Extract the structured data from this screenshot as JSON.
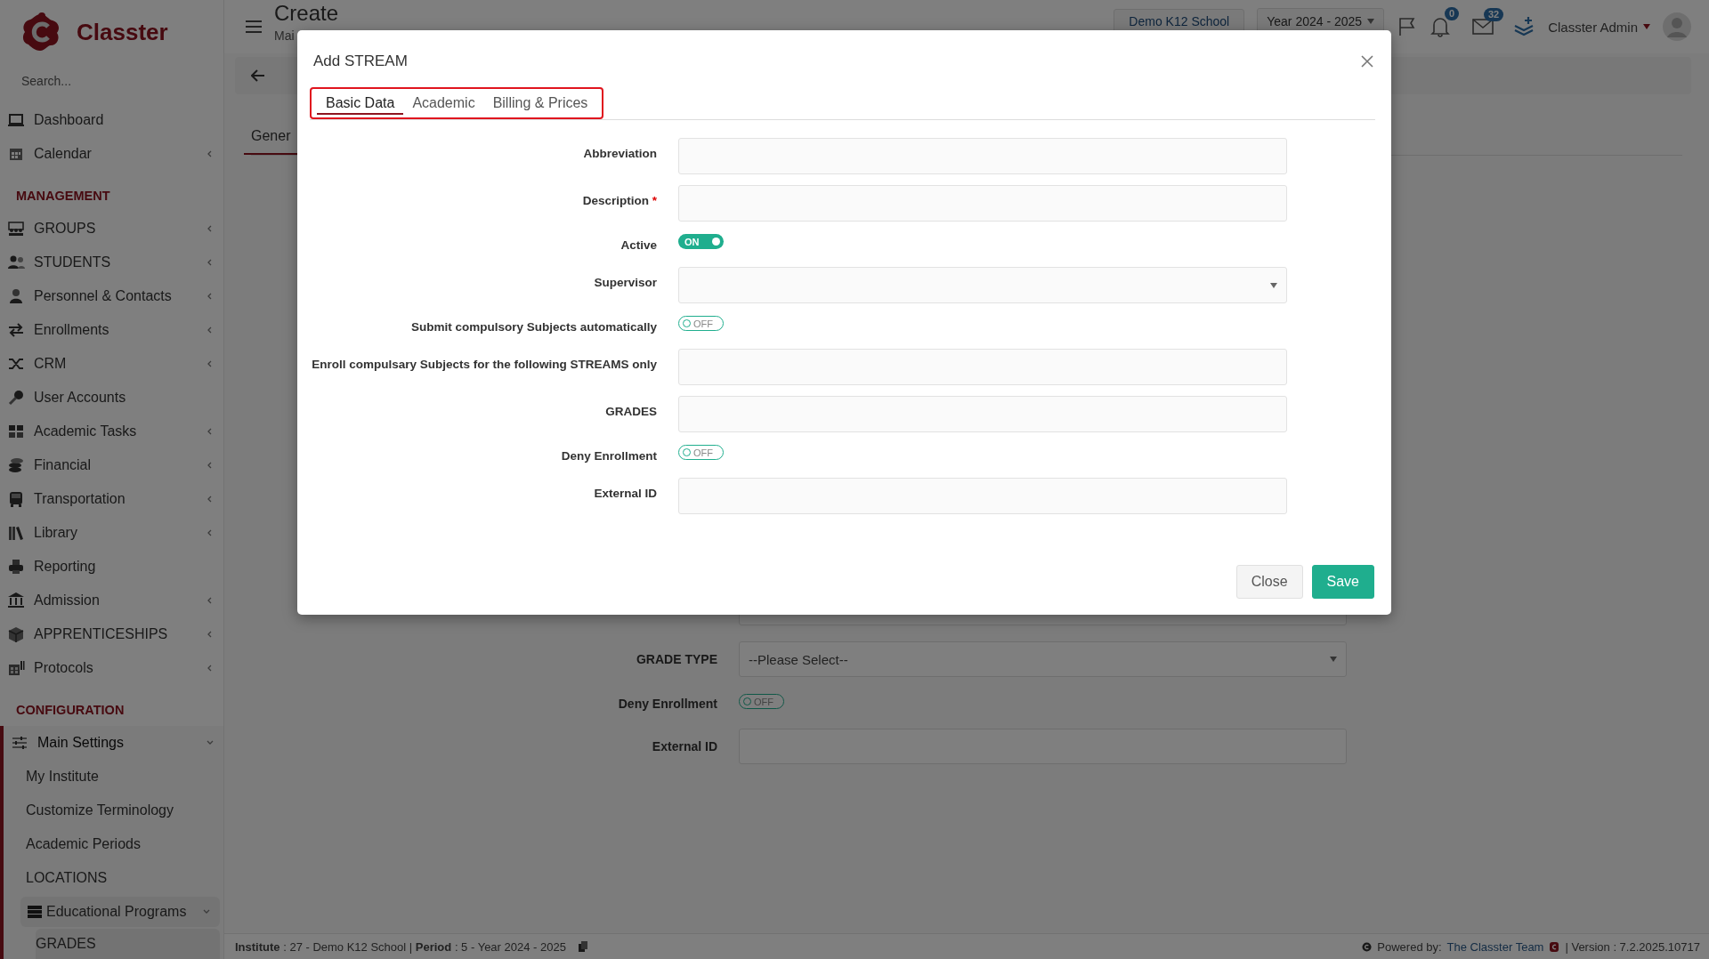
{
  "sidebar": {
    "brand": "Classter",
    "search": {
      "placeholder": "Search..."
    },
    "nav": [
      {
        "kind": "item",
        "label": "Dashboard",
        "selected": false
      },
      {
        "kind": "item",
        "label": "Calendar",
        "selected": false,
        "expanded": false
      },
      {
        "kind": "heading",
        "label": "MANAGEMENT"
      },
      {
        "kind": "item",
        "label": "GROUPS",
        "selected": false,
        "expanded": false
      },
      {
        "kind": "item",
        "label": "STUDENTS",
        "selected": false,
        "expanded": false
      },
      {
        "kind": "item",
        "label": "Personnel & Contacts",
        "selected": false,
        "expanded": false
      },
      {
        "kind": "item",
        "label": "Enrollments",
        "selected": false,
        "expanded": false
      },
      {
        "kind": "item",
        "label": "CRM",
        "selected": false,
        "expanded": false
      },
      {
        "kind": "item",
        "label": "User Accounts",
        "selected": false
      },
      {
        "kind": "item",
        "label": "Academic Tasks",
        "selected": false,
        "expanded": false
      },
      {
        "kind": "item",
        "label": "Financial",
        "selected": false,
        "expanded": false
      },
      {
        "kind": "item",
        "label": "Transportation",
        "selected": false,
        "expanded": false
      },
      {
        "kind": "item",
        "label": "Library",
        "selected": false,
        "expanded": false
      },
      {
        "kind": "item",
        "label": "Reporting",
        "selected": false
      },
      {
        "kind": "item",
        "label": "Admission",
        "selected": false,
        "expanded": false
      },
      {
        "kind": "item",
        "label": "APPRENTICESHIPS",
        "selected": false,
        "expanded": false
      },
      {
        "kind": "item",
        "label": "Protocols",
        "selected": false,
        "expanded": false
      },
      {
        "kind": "heading",
        "label": "CONFIGURATION"
      },
      {
        "kind": "item",
        "label": "Main Settings",
        "selected": true,
        "expanded": true,
        "children": [
          {
            "label": "My Institute",
            "selected": false
          },
          {
            "label": "Customize Terminology",
            "selected": false
          },
          {
            "label": "Academic Periods",
            "selected": false
          },
          {
            "label": "LOCATIONS",
            "selected": false
          },
          {
            "label": "Educational Programs",
            "selected": true,
            "expanded": true,
            "children": [
              {
                "label": "GRADES",
                "selected": true
              }
            ]
          }
        ]
      }
    ]
  },
  "topbar": {
    "title": "Create",
    "subtitle": "Mai",
    "school": "Demo K12 School",
    "year": "Year 2024 - 2025",
    "notifications_badge": "0",
    "messages_badge": "32",
    "user": "Classter Admin"
  },
  "page": {
    "tabs": [
      {
        "label": "Gener",
        "selected": true
      }
    ],
    "form": [
      {
        "kind": "text"
      },
      {
        "kind": "select",
        "label": "GRADE TYPE",
        "placeholder": "--Please Select--"
      },
      {
        "kind": "toggle",
        "label": "Deny Enrollment",
        "on": false,
        "state_text": "OFF"
      },
      {
        "kind": "text",
        "label": "External ID"
      }
    ]
  },
  "modal": {
    "title": "Add STREAM",
    "tabs": {
      "highlighted": true,
      "items": [
        {
          "label": "Basic Data",
          "selected": true
        },
        {
          "label": "Academic",
          "selected": false
        },
        {
          "label": "Billing & Prices",
          "selected": false
        }
      ]
    },
    "fields": [
      {
        "kind": "text",
        "label": "Abbreviation"
      },
      {
        "kind": "text",
        "label": "Description",
        "required_mark": "*"
      },
      {
        "kind": "toggle",
        "label": "Active",
        "on": true,
        "state_text": "ON"
      },
      {
        "kind": "select",
        "label": "Supervisor"
      },
      {
        "kind": "toggle",
        "label": "Submit compulsory Subjects automatically",
        "on": false,
        "state_text": "OFF"
      },
      {
        "kind": "text",
        "label": "Enroll compulsary Subjects for the following STREAMS only"
      },
      {
        "kind": "text",
        "label": "GRADES"
      },
      {
        "kind": "toggle",
        "label": "Deny Enrollment",
        "on": false,
        "state_text": "OFF"
      },
      {
        "kind": "text",
        "label": "External ID"
      }
    ],
    "buttons": [
      {
        "label": "Close",
        "kind": "secondary"
      },
      {
        "label": "Save",
        "kind": "primary"
      }
    ]
  },
  "footer": {
    "info": "**Institute** : 27 - Demo K12 School | **Period** : 5 - Year 2024 - 2025",
    "powered_by": "Powered by:",
    "team_link": "The Classter Team",
    "version": "| Version : 7.2.2025.10717"
  }
}
